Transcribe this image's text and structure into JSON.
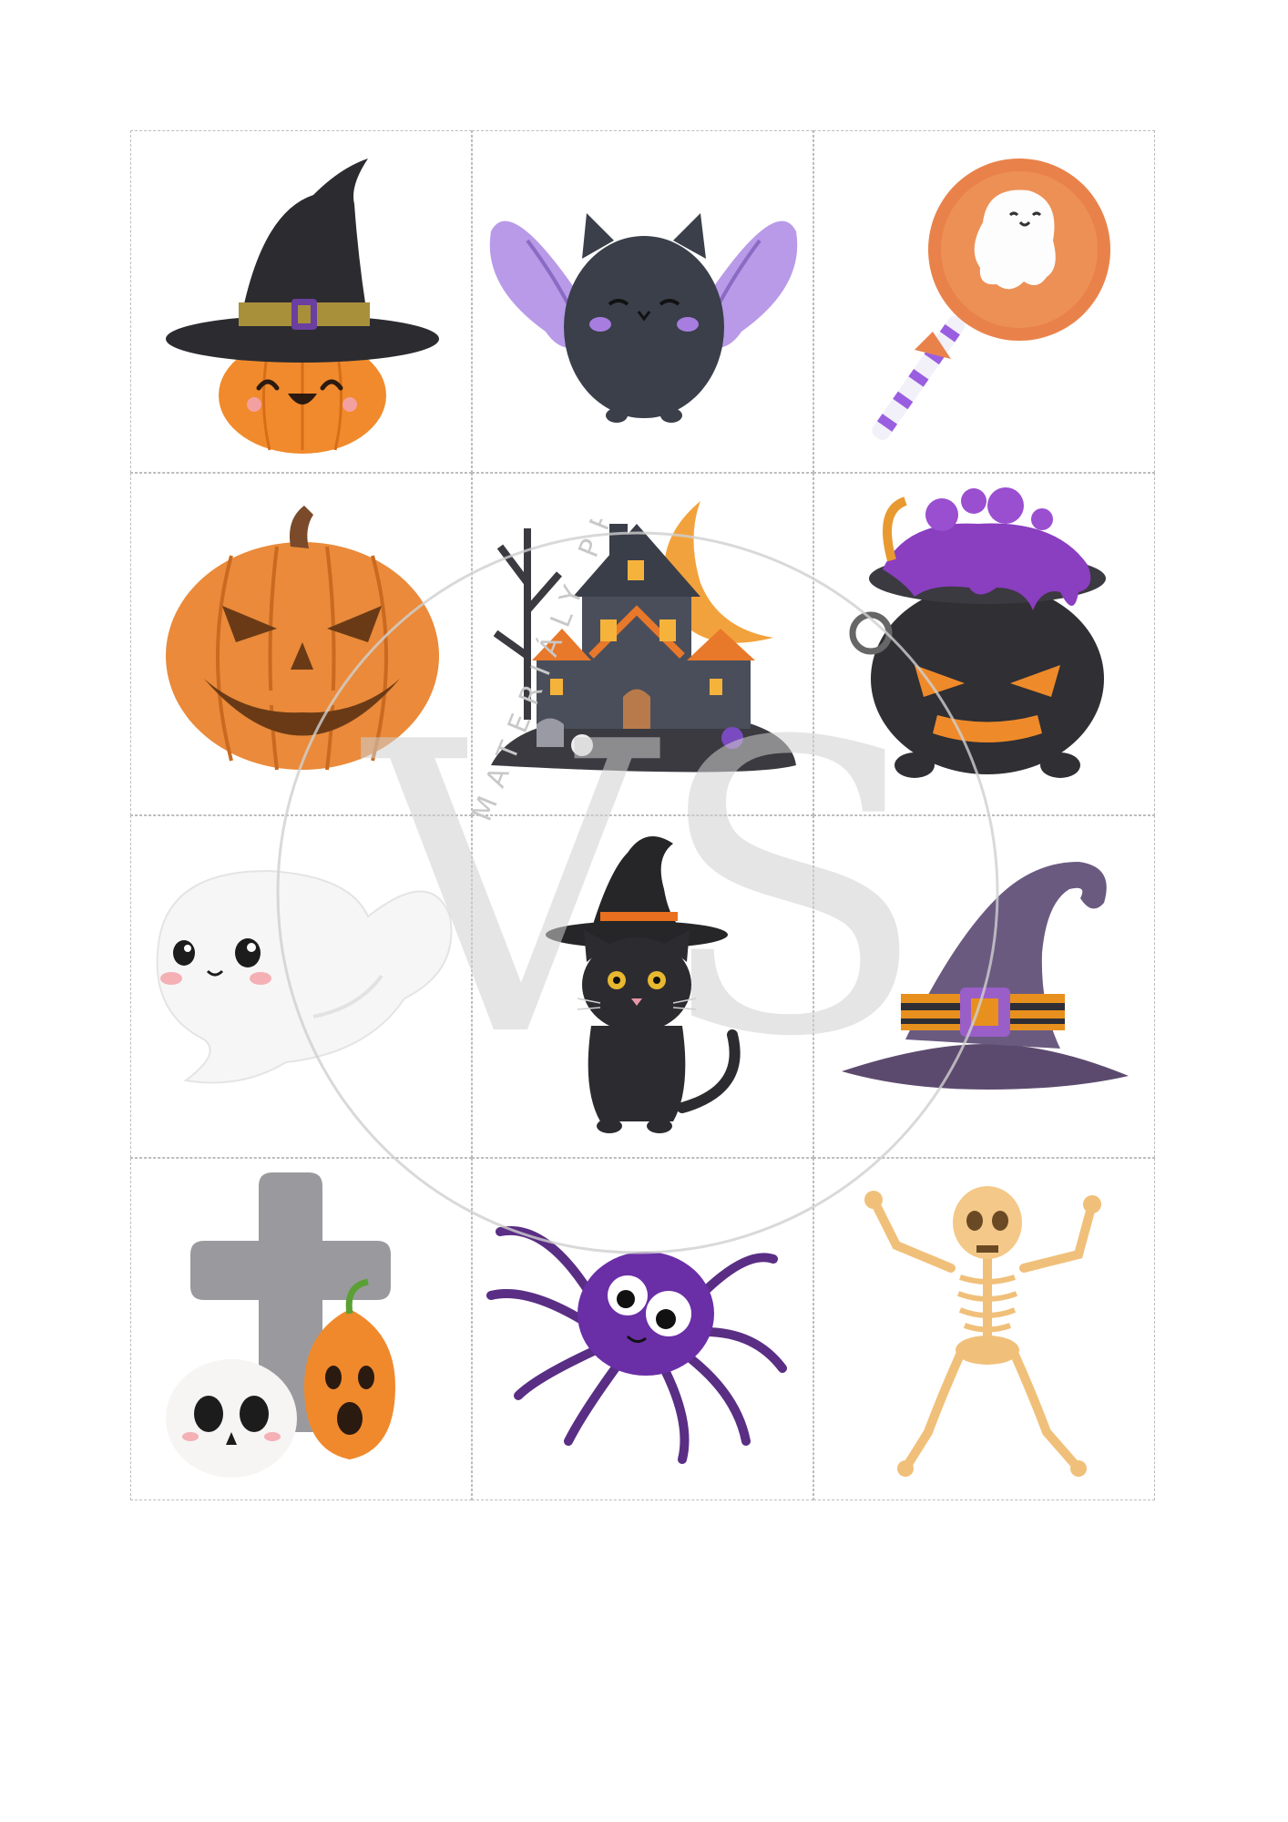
{
  "watermark": {
    "brand_text": "MATERIÁLY PRO DĚTI",
    "monogram": "VS",
    "color": "#c8c8c8"
  },
  "cards": [
    {
      "name": "pumpkin-witch-hat",
      "icon": "pumpkin-with-witch-hat-icon"
    },
    {
      "name": "bat",
      "icon": "cute-bat-icon"
    },
    {
      "name": "ghost-lollipop",
      "icon": "ghost-lollipop-icon"
    },
    {
      "name": "jack-o-lantern",
      "icon": "jack-o-lantern-icon"
    },
    {
      "name": "haunted-house",
      "icon": "haunted-house-moon-icon"
    },
    {
      "name": "cauldron",
      "icon": "bubbling-cauldron-icon"
    },
    {
      "name": "ghost",
      "icon": "cute-ghost-icon"
    },
    {
      "name": "black-cat",
      "icon": "black-cat-witch-hat-icon"
    },
    {
      "name": "witch-hat",
      "icon": "purple-witch-hat-icon"
    },
    {
      "name": "grave",
      "icon": "cross-skull-pumpkin-icon"
    },
    {
      "name": "spider",
      "icon": "purple-spider-icon"
    },
    {
      "name": "skeleton",
      "icon": "dancing-skeleton-icon"
    }
  ],
  "colors": {
    "orange": "#f08a2c",
    "black": "#2b2b30",
    "purple": "#8a5cc4",
    "cut_line": "#bcbcbc"
  }
}
